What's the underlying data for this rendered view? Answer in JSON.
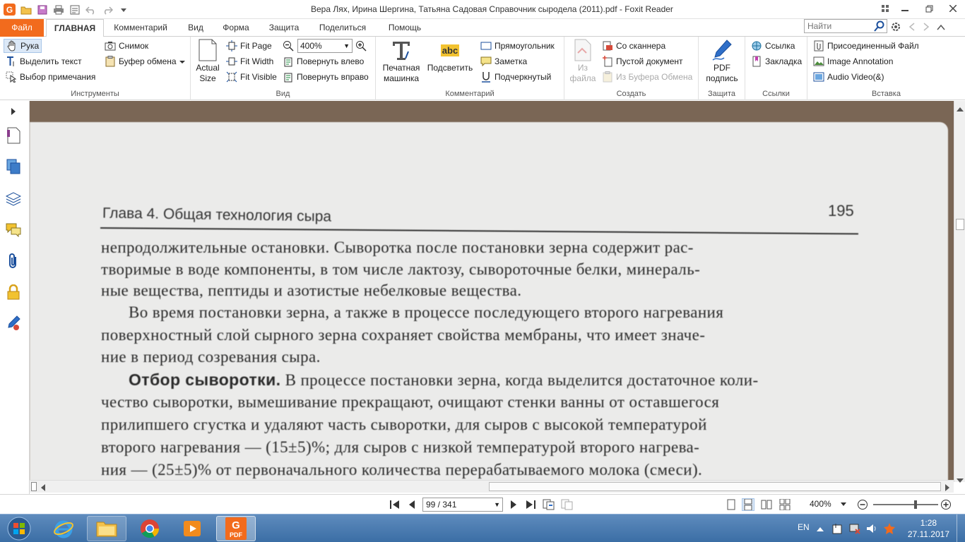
{
  "window": {
    "title": "Вера Лях, Ирина Шергина, Татьяна Садовая Справочник сыродела (2011).pdf - Foxit Reader",
    "app_logo": "G"
  },
  "menu": {
    "file": "Файл",
    "tabs": [
      "ГЛАВНАЯ",
      "Комментарий",
      "Вид",
      "Форма",
      "Защита",
      "Поделиться",
      "Помощь"
    ],
    "search_placeholder": "Найти"
  },
  "ribbon": {
    "tools": {
      "label": "Инструменты",
      "hand": "Рука",
      "select_text": "Выделить текст",
      "select_annotation": "Выбор примечания",
      "snapshot": "Снимок",
      "clipboard": "Буфер обмена"
    },
    "view": {
      "label": "Вид",
      "actual_size": "Actual Size",
      "fit_page": "Fit Page",
      "fit_width": "Fit Width",
      "fit_visible": "Fit Visible",
      "zoom": "400%",
      "rotate_left": "Повернуть влево",
      "rotate_right": "Повернуть вправо"
    },
    "comment": {
      "label": "Комментарий",
      "typewriter": "Печатная машинка",
      "highlight": "Подсветить",
      "highlight_icon_text": "abc",
      "rectangle": "Прямоугольник",
      "note": "Заметка",
      "underline": "Подчеркнутый"
    },
    "create": {
      "label": "Создать",
      "from_file": "Из файла",
      "from_scanner": "Со сканнера",
      "blank": "Пустой документ",
      "from_clipboard": "Из Буфера Обмена"
    },
    "protect": {
      "label": "Защита",
      "pdf_sign": "PDF подпись"
    },
    "links": {
      "label": "Ссылки",
      "link": "Ссылка",
      "bookmark": "Закладка"
    },
    "insert": {
      "label": "Вставка",
      "attachment": "Присоединенный Файл",
      "image_annotation": "Image Annotation",
      "audio_video": "Audio  Video(&)"
    }
  },
  "document": {
    "chapter": "Глава 4. Общая технология сыра",
    "page_number": "195",
    "lines": [
      "непродолжительные остановки. Сыворотка после постановки зерна содержит рас-",
      "творимые в воде компоненты, в том числе лактозу, сывороточные белки, минераль-",
      "ные вещества, пептиды и азотистые небелковые вещества.",
      "Во время постановки зерна, а также в процессе последующего второго нагревания",
      "поверхностный слой сырного зерна сохраняет свойства мембраны, что имеет значе-",
      "ние в период созревания сыра.",
      "В процессе постановки зерна, когда выделится достаточное коли-",
      "чество сыворотки, вымешивание прекращают, очищают стенки ванны от оставшегося",
      "прилипшего сгустка и удаляют часть сыворотки, для сыров с высокой температурой",
      "второго нагревания — (15±5)%; для сыров с низкой температурой второго нагрева-",
      "ния — (25±5)% от первоначального количества перерабатываемого молока (смеси)."
    ],
    "bold_heading": "Отбор сыворотки."
  },
  "statusbar": {
    "page": "99 / 341",
    "zoom": "400%"
  },
  "taskbar": {
    "lang": "EN",
    "time": "1:28",
    "date": "27.11.2017",
    "foxit_label": "PDF"
  }
}
